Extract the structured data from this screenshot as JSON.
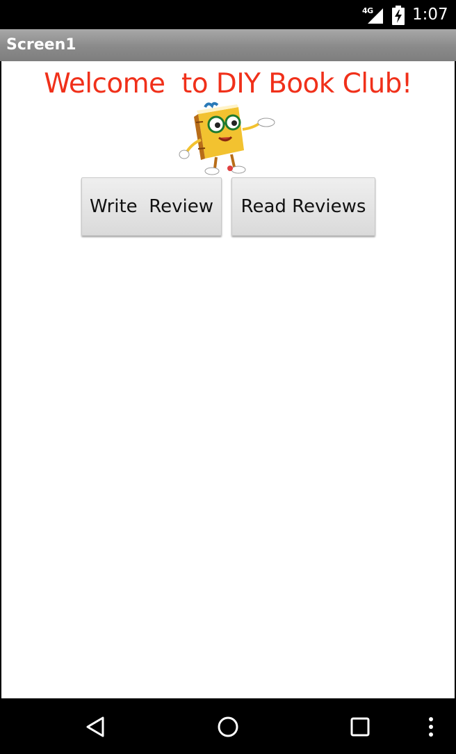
{
  "status_bar": {
    "network_label": "4G",
    "time": "1:07",
    "icons": [
      "signal-icon",
      "battery-charging-icon"
    ]
  },
  "title_bar": {
    "title": "Screen1"
  },
  "main": {
    "welcome_text": "Welcome  to DIY Book Club!",
    "welcome_color": "#f0301a",
    "mascot": "book-mascot-image",
    "buttons": {
      "write_review": "Write  Review",
      "read_reviews": "Read Reviews"
    }
  },
  "nav_bar": {
    "icons": [
      "back-icon",
      "home-icon",
      "recents-icon",
      "overflow-menu-icon"
    ]
  }
}
